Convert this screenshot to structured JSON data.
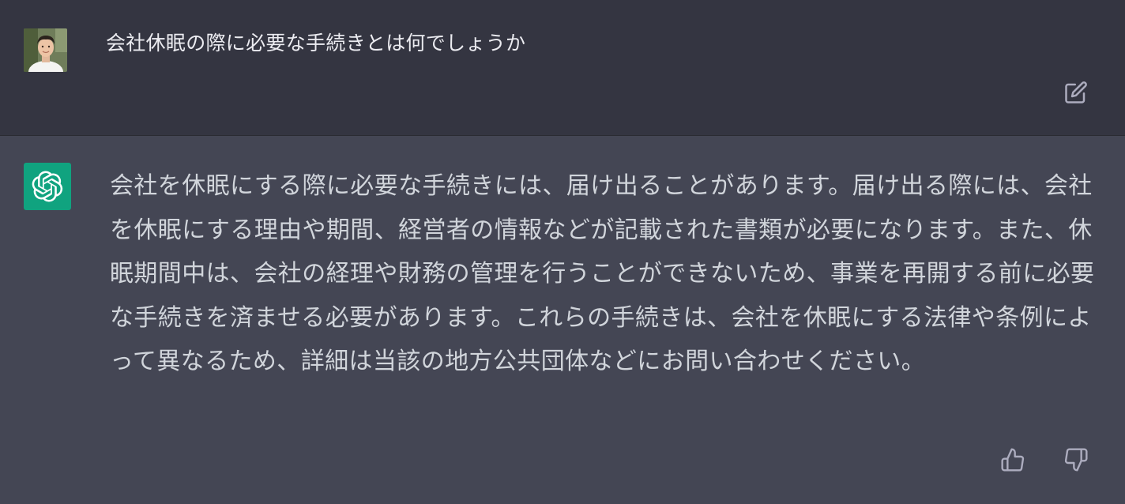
{
  "conversation": {
    "user_message": {
      "text": "会社休眠の際に必要な手続きとは何でしょうか",
      "avatar_icon": "user-photo-avatar",
      "edit_icon": "edit-icon"
    },
    "assistant_message": {
      "avatar_icon": "openai-logo-icon",
      "avatar_color": "#10a37f",
      "text": "会社を休眠にする際に必要な手続きには、届け出ることがあります。届け出る際には、会社を休眠にする理由や期間、経営者の情報などが記載された書類が必要になります。また、休眠期間中は、会社の経理や財務の管理を行うことができないため、事業を再開する前に必要な手続きを済ませる必要があります。これらの手続きは、会社を休眠にする法律や条例によって異なるため、詳細は当該の地方公共団体などにお問い合わせください。",
      "feedback_icons": [
        "thumbs-up-icon",
        "thumbs-down-icon"
      ]
    }
  },
  "colors": {
    "user_row_bg": "#343541",
    "assistant_row_bg": "#444654",
    "user_text": "#ececf1",
    "assistant_text": "#d1d5db",
    "icon_gray": "#acacbe"
  }
}
